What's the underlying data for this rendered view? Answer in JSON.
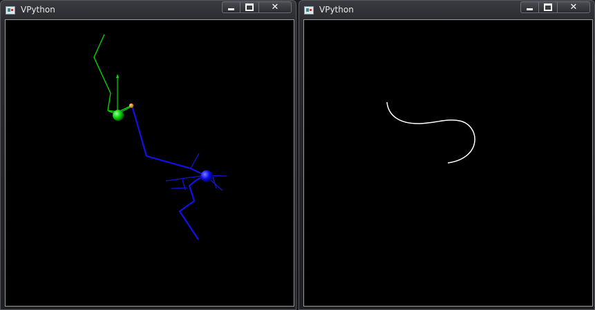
{
  "windows": [
    {
      "title": "VPython",
      "controls": {
        "minimize": "minimize",
        "maximize": "maximize",
        "close": "close"
      },
      "scene": "two spheres (green and blue) with random-walk trails and arrows"
    },
    {
      "title": "VPython",
      "controls": {
        "minimize": "minimize",
        "maximize": "maximize",
        "close": "close"
      },
      "scene": "white curve"
    }
  ],
  "colors": {
    "green": "#00e000",
    "blue": "#1010ff",
    "orange": "#ff8c00",
    "curve": "#ffffff",
    "background": "#000000"
  }
}
